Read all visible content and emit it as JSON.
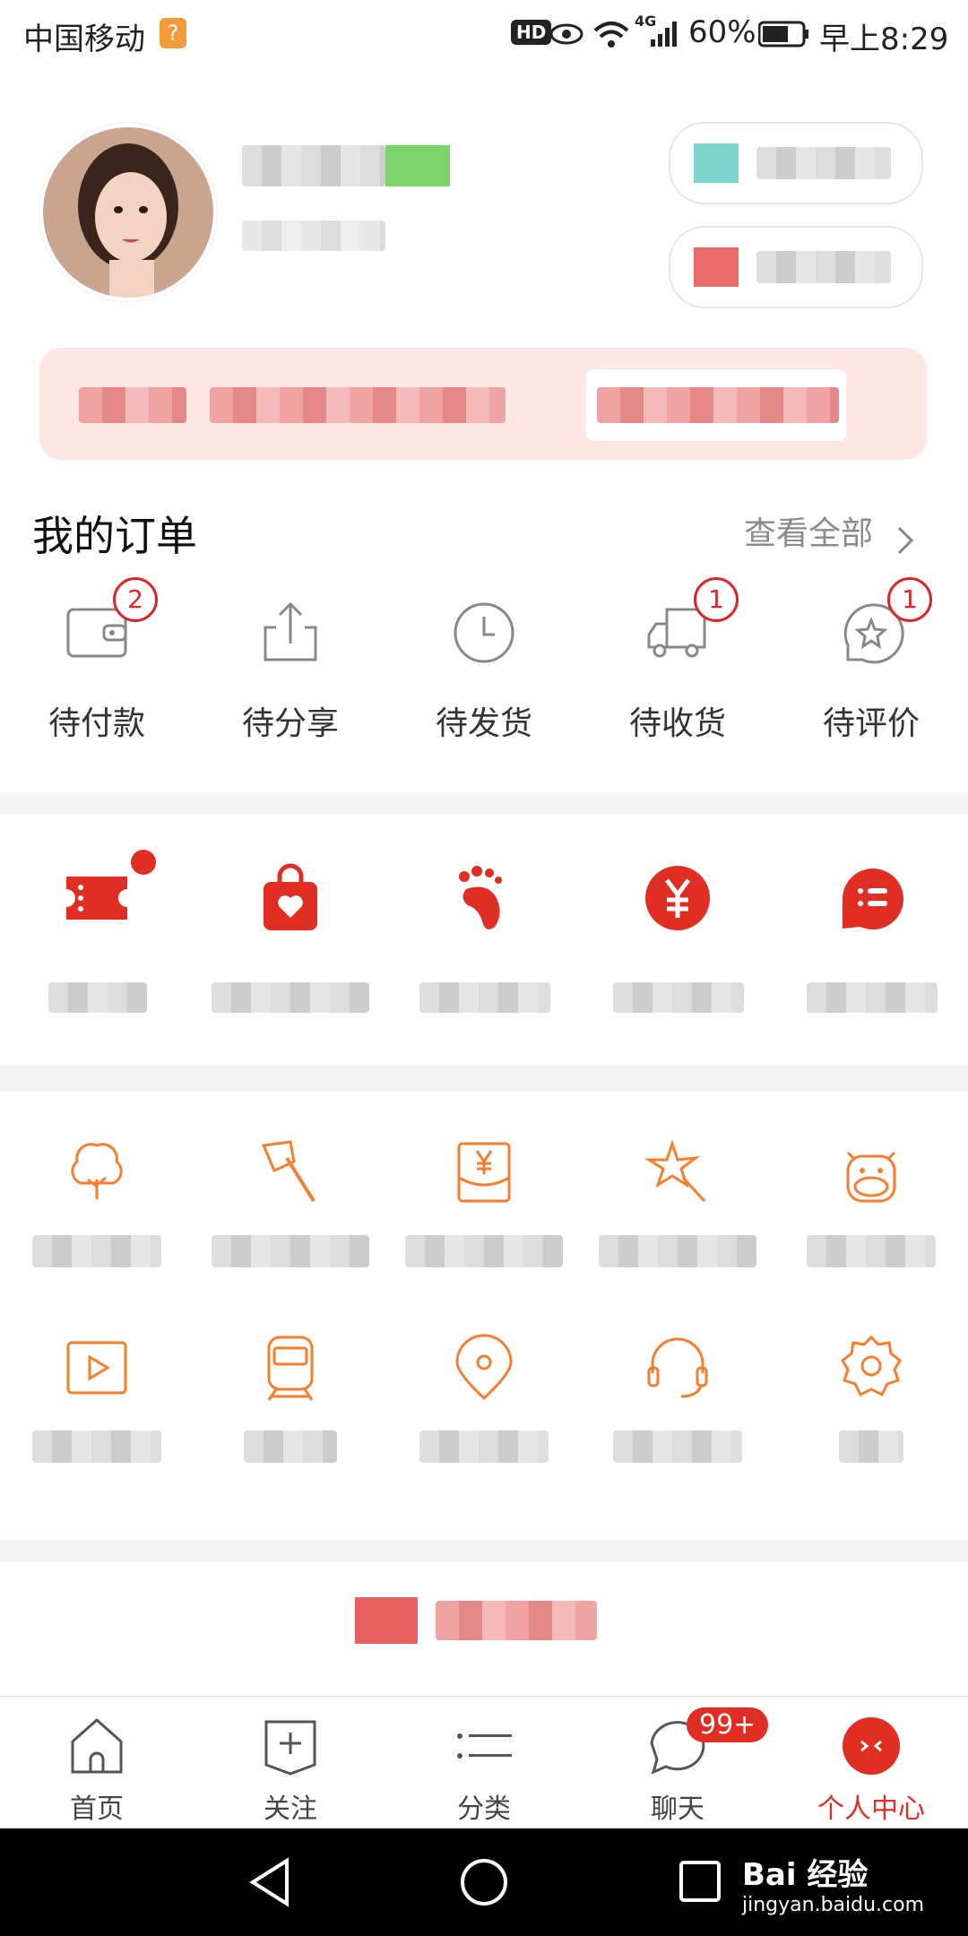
{
  "status_bar": {
    "carrier": "中国移动",
    "carrier_badge": "?",
    "hd": "HD",
    "network": "4G",
    "battery": "60%",
    "time": "早上8:29"
  },
  "orders": {
    "title": "我的订单",
    "view_all": "查看全部",
    "items": [
      {
        "label": "待付款",
        "icon": "wallet-icon",
        "badge": "2"
      },
      {
        "label": "待分享",
        "icon": "share-icon",
        "badge": ""
      },
      {
        "label": "待发货",
        "icon": "clock-icon",
        "badge": ""
      },
      {
        "label": "待收货",
        "icon": "truck-icon",
        "badge": "1"
      },
      {
        "label": "待评价",
        "icon": "review-star-icon",
        "badge": "1"
      }
    ]
  },
  "feature_icons": [
    "coupon-icon",
    "shopping-bag-icon",
    "footprint-icon",
    "yuan-coin-icon",
    "list-bubble-icon"
  ],
  "service_icons": [
    "tree-icon",
    "axe-icon",
    "red-envelope-icon",
    "star-wand-icon",
    "cow-icon",
    "video-play-icon",
    "train-icon",
    "location-pin-icon",
    "headset-icon",
    "settings-gear-icon"
  ],
  "bottom_nav": {
    "items": [
      {
        "label": "首页",
        "icon": "home-icon"
      },
      {
        "label": "关注",
        "icon": "follow-plus-icon"
      },
      {
        "label": "分类",
        "icon": "category-list-icon"
      },
      {
        "label": "聊天",
        "icon": "chat-bubble-icon",
        "badge": "99+"
      },
      {
        "label": "个人中心",
        "icon": "profile-face-icon"
      }
    ]
  },
  "watermark": {
    "logo_text": "Bai 经验",
    "url": "jingyan.baidu.com"
  },
  "colors": {
    "accent": "#e02e24",
    "service_orange": "#f57e2f",
    "badge_red": "#d8262d"
  }
}
